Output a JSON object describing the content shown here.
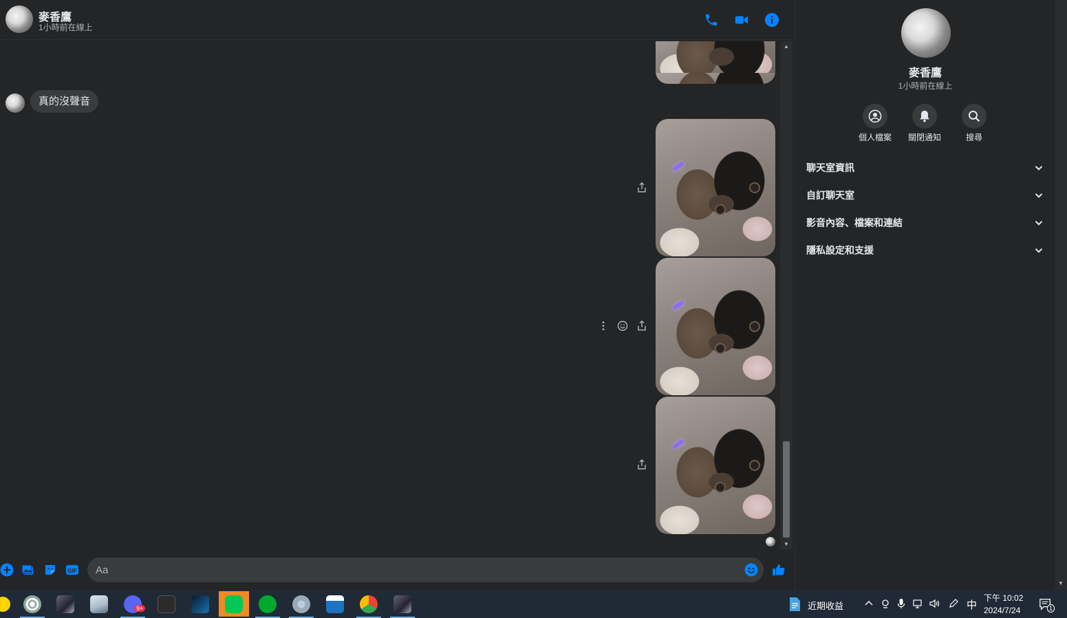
{
  "header": {
    "name": "麥香鷹",
    "status": "1小時前在線上",
    "icons": [
      "phone-icon",
      "video-camera-icon",
      "info-icon"
    ]
  },
  "colors": {
    "accent": "#0084ff",
    "background": "#242526",
    "bubble": "#3a3b3c",
    "text": "#e4e6eb",
    "muted": "#b0b3b8",
    "taskbar": "#202a36",
    "line_app": "#f08a24"
  },
  "messages": [
    {
      "type": "photo",
      "direction": "sent"
    },
    {
      "type": "text",
      "direction": "received",
      "text": "真的沒聲音"
    },
    {
      "type": "photo",
      "direction": "sent"
    },
    {
      "type": "photo",
      "direction": "sent"
    },
    {
      "type": "photo",
      "direction": "sent"
    }
  ],
  "composer": {
    "placeholder": "Aa",
    "icons": [
      "plus-icon",
      "image-icon",
      "sticker-icon",
      "gif-icon",
      "emoji-icon",
      "like-icon"
    ]
  },
  "panel": {
    "name": "麥香鷹",
    "status": "1小時前在線上",
    "actions": [
      {
        "label": "個人檔案",
        "icon": "profile-icon"
      },
      {
        "label": "關閉通知",
        "icon": "bell-icon"
      },
      {
        "label": "搜尋",
        "icon": "search-icon"
      }
    ],
    "sections": [
      {
        "title": "聊天室資訊"
      },
      {
        "title": "自訂聊天室"
      },
      {
        "title": "影音內容、檔案和連結"
      },
      {
        "title": "隱私設定和支援"
      }
    ]
  },
  "taskbar": {
    "news_label": "近期收益",
    "ime": "中",
    "time": "下午 10:02",
    "date": "2024/7/24",
    "notification_count": "1",
    "app_badge": "9+"
  }
}
